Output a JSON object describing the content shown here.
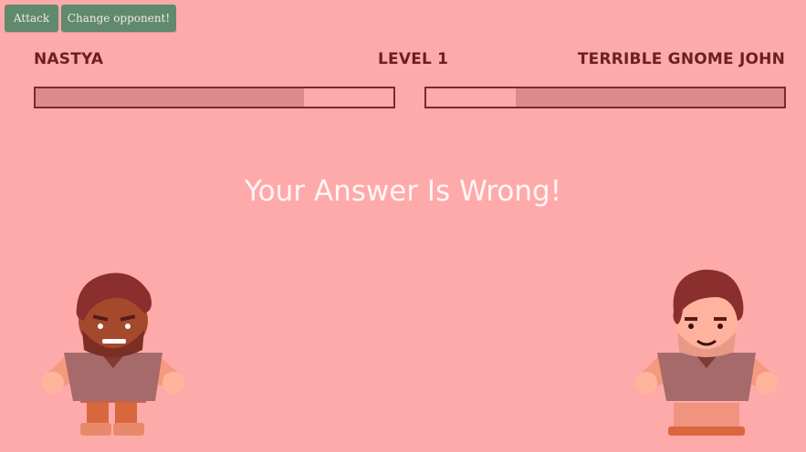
{
  "controls": {
    "attack_label": "Attack",
    "change_label": "Change opponent!"
  },
  "player": {
    "name": "NASTYA",
    "health": 0.75
  },
  "level": {
    "label": "LEVEL 1"
  },
  "opponent": {
    "name": "TERRIBLE GNOME JOHN",
    "health": 0.75
  },
  "message": "Your Answer Is Wrong!",
  "colors": {
    "background": "#ffaaaa",
    "button": "#5f8a6e",
    "health_fill": "#df8a8a",
    "text_dark": "#6b1f24"
  }
}
